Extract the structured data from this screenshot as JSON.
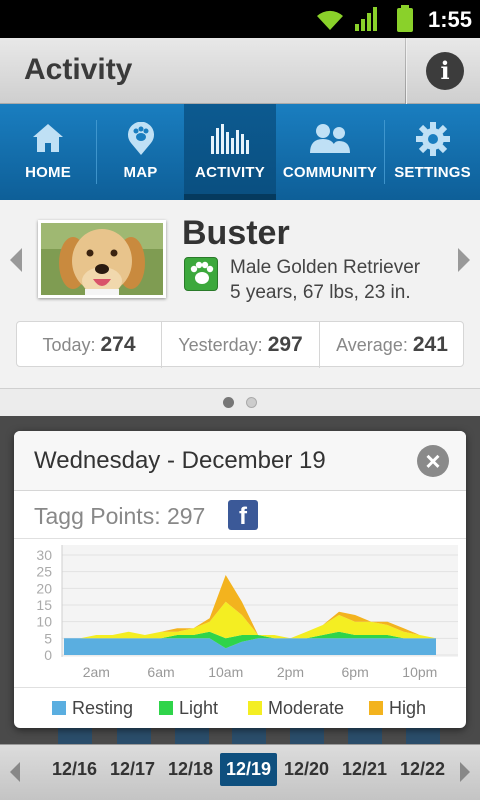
{
  "status_bar": {
    "time": "1:55"
  },
  "title_bar": {
    "title": "Activity",
    "info_icon": "i"
  },
  "nav": {
    "tabs": [
      {
        "label": "HOME",
        "icon": "home-icon"
      },
      {
        "label": "MAP",
        "icon": "map-paw-icon"
      },
      {
        "label": "ACTIVITY",
        "icon": "activity-bars-icon",
        "active": true
      },
      {
        "label": "COMMUNITY",
        "icon": "community-icon"
      },
      {
        "label": "SETTINGS",
        "icon": "gear-icon"
      }
    ]
  },
  "profile": {
    "name": "Buster",
    "breed": "Male Golden Retriever",
    "details": "5 years, 67 lbs, 23 in.",
    "stats": [
      {
        "label": "Today:",
        "value": "274"
      },
      {
        "label": "Yesterday:",
        "value": "297"
      },
      {
        "label": "Average:",
        "value": "241"
      }
    ]
  },
  "dialog": {
    "title": "Wednesday - December 19",
    "points": "Tagg Points: 297",
    "close_icon": "close-icon",
    "share_icon": "facebook-icon"
  },
  "dates": {
    "items": [
      "12/16",
      "12/17",
      "12/18",
      "12/19",
      "12/20",
      "12/21",
      "12/22"
    ],
    "selected": "12/19"
  },
  "colors": {
    "resting": "#5aaee0",
    "light": "#2fd44a",
    "moderate": "#f4ee22",
    "high": "#f3b31e",
    "nav_blue": "#1a7ec0"
  },
  "chart_data": {
    "type": "area",
    "x_ticks": [
      "2am",
      "6am",
      "10am",
      "2pm",
      "6pm",
      "10pm"
    ],
    "y_ticks": [
      "30",
      "25",
      "20",
      "15",
      "10",
      "5",
      "0"
    ],
    "ylim": [
      0,
      30
    ],
    "hours": [
      0,
      1,
      2,
      3,
      4,
      5,
      6,
      7,
      8,
      9,
      10,
      11,
      12,
      13,
      14,
      15,
      16,
      17,
      18,
      19,
      20,
      21,
      22,
      23
    ],
    "series": [
      {
        "name": "Resting",
        "values": [
          5,
          5,
          5,
          5,
          5,
          5,
          5,
          5,
          5,
          5,
          2,
          4,
          5,
          5,
          5,
          5,
          5,
          5,
          5,
          5,
          5,
          5,
          5,
          5
        ]
      },
      {
        "name": "Light",
        "values": [
          0,
          0,
          0,
          0,
          0,
          0,
          0,
          1,
          1,
          2,
          3,
          2,
          1,
          0,
          0,
          0,
          1,
          2,
          1,
          1,
          1,
          0,
          0,
          0
        ]
      },
      {
        "name": "Moderate",
        "values": [
          0,
          0,
          1,
          1,
          2,
          1,
          2,
          1,
          2,
          3,
          11,
          6,
          0,
          1,
          0,
          2,
          3,
          5,
          4,
          4,
          3,
          2,
          1,
          0
        ]
      },
      {
        "name": "High",
        "values": [
          0,
          0,
          0,
          0,
          0,
          0,
          0,
          1,
          0,
          1,
          8,
          4,
          0,
          0,
          0,
          0,
          0,
          1,
          2,
          0,
          1,
          1,
          0,
          0
        ]
      }
    ]
  },
  "legend": [
    "Resting",
    "Light",
    "Moderate",
    "High"
  ]
}
